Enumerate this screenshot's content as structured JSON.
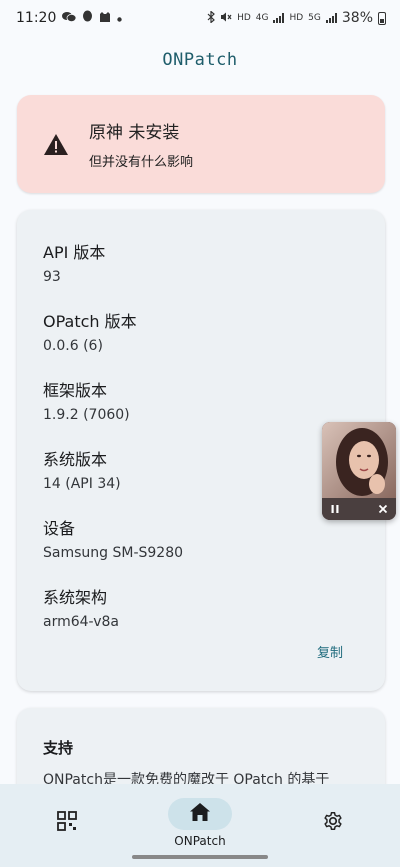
{
  "status_bar": {
    "time": "11:20",
    "battery": "38%",
    "hd1": "HD",
    "net1": "4G",
    "hd2": "HD",
    "net2": "5G"
  },
  "app": {
    "title": "ONPatch"
  },
  "warning": {
    "title": "原神 未安装",
    "subtitle": "但并没有什么影响",
    "color": "#fadcd9"
  },
  "info": {
    "items": [
      {
        "label": "API 版本",
        "value": "93"
      },
      {
        "label": "OPatch 版本",
        "value": "0.0.6 (6)"
      },
      {
        "label": "框架版本",
        "value": "1.9.2 (7060)"
      },
      {
        "label": "系统版本",
        "value": "14 (API 34)"
      },
      {
        "label": "设备",
        "value": "Samsung SM-S9280"
      },
      {
        "label": "系统架构",
        "value": "arm64-v8a"
      }
    ],
    "copy_label": "复制"
  },
  "support": {
    "title": "支持",
    "text": "ONPatch是一款免费的魔改于 OPatch 的基于"
  },
  "floating_player": {
    "pause_icon": "pause-icon",
    "close_icon": "close-icon"
  },
  "bottom_nav": {
    "items": [
      {
        "label": "",
        "icon": "grid-icon"
      },
      {
        "label": "ONPatch",
        "icon": "home-icon",
        "active": true
      },
      {
        "label": "",
        "icon": "gear-icon"
      }
    ]
  },
  "colors": {
    "accent": "#1f6b7d",
    "title": "#1f5d6b",
    "card": "#edf1f4",
    "nav_bg": "#e5eef3"
  }
}
